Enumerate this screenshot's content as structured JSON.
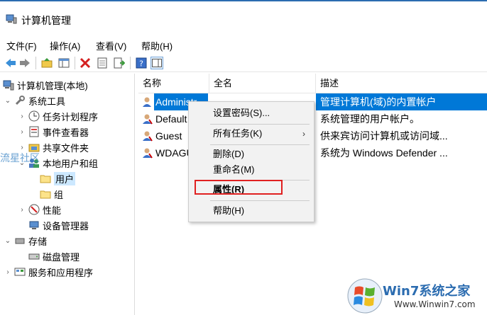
{
  "window": {
    "title": "计算机管理"
  },
  "menu": {
    "file": "文件(F)",
    "action": "操作(A)",
    "view": "查看(V)",
    "help": "帮助(H)"
  },
  "tree": {
    "root": "计算机管理(本地)",
    "system_tools": "系统工具",
    "task_scheduler": "任务计划程序",
    "event_viewer": "事件查看器",
    "shared_folders": "共享文件夹",
    "local_users_groups": "本地用户和组",
    "users": "用户",
    "groups": "组",
    "performance": "性能",
    "device_manager": "设备管理器",
    "storage": "存储",
    "disk_management": "磁盘管理",
    "services_apps": "服务和应用程序"
  },
  "list": {
    "headers": {
      "name": "名称",
      "fullname": "全名",
      "desc": "描述"
    },
    "rows": [
      {
        "name": "Administr",
        "desc": "管理计算机(域)的内置帐户"
      },
      {
        "name": "Default",
        "desc": "系统管理的用户帐户。"
      },
      {
        "name": "Guest",
        "desc": "供来宾访问计算机或访问域..."
      },
      {
        "name": "WDAGU",
        "desc": "系统为 Windows Defender ..."
      }
    ]
  },
  "context_menu": {
    "set_password": "设置密码(S)...",
    "all_tasks": "所有任务(K)",
    "delete": "删除(D)",
    "rename": "重命名(M)",
    "properties": "属性(R)",
    "help": "帮助(H)"
  },
  "watermark": {
    "left": "流星社区",
    "brand": "Win7系统之家",
    "url": "Www.Winwin7.com"
  },
  "colors": {
    "selection": "#0078d7",
    "highlight_box": "#e02020",
    "tree_selected": "#cce8ff"
  }
}
